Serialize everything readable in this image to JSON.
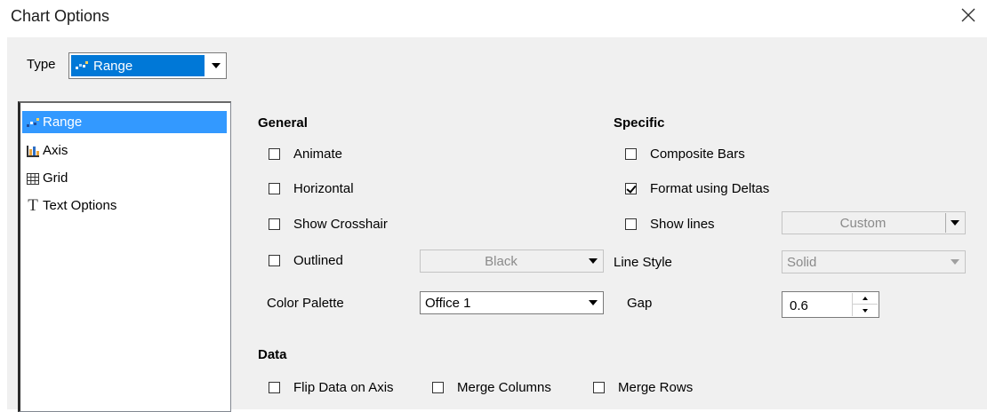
{
  "window": {
    "title": "Chart Options"
  },
  "type": {
    "label": "Type",
    "value": "Range"
  },
  "tree": {
    "items": [
      {
        "label": "Range",
        "icon": "range-icon",
        "selected": true
      },
      {
        "label": "Axis",
        "icon": "axis-icon",
        "selected": false
      },
      {
        "label": "Grid",
        "icon": "grid-icon",
        "selected": false
      },
      {
        "label": "Text Options",
        "icon": "text-options-icon",
        "selected": false
      }
    ]
  },
  "general": {
    "heading": "General",
    "animate": {
      "label": "Animate",
      "checked": false
    },
    "horizontal": {
      "label": "Horizontal",
      "checked": false
    },
    "crosshair": {
      "label": "Show Crosshair",
      "checked": false
    },
    "outlined": {
      "label": "Outlined",
      "checked": false,
      "color": "Black",
      "enabled": false
    },
    "palette": {
      "label": "Color Palette",
      "value": "Office 1"
    }
  },
  "specific": {
    "heading": "Specific",
    "composite": {
      "label": "Composite Bars",
      "checked": false
    },
    "deltas": {
      "label": "Format using Deltas",
      "checked": true
    },
    "lines": {
      "label": "Show lines",
      "checked": false,
      "value": "Custom",
      "enabled": false
    },
    "line_style": {
      "label": "Line Style",
      "value": "Solid",
      "enabled": false
    },
    "gap": {
      "label": "Gap",
      "value": "0.6"
    }
  },
  "data": {
    "heading": "Data",
    "flip": {
      "label": "Flip Data on Axis",
      "checked": false
    },
    "merge_columns": {
      "label": "Merge Columns",
      "checked": false
    },
    "merge_rows": {
      "label": "Merge Rows",
      "checked": false
    }
  },
  "colors": {
    "selection": "#0078d7",
    "tree_selection": "#3399ff",
    "panel": "#f0f0f0"
  }
}
